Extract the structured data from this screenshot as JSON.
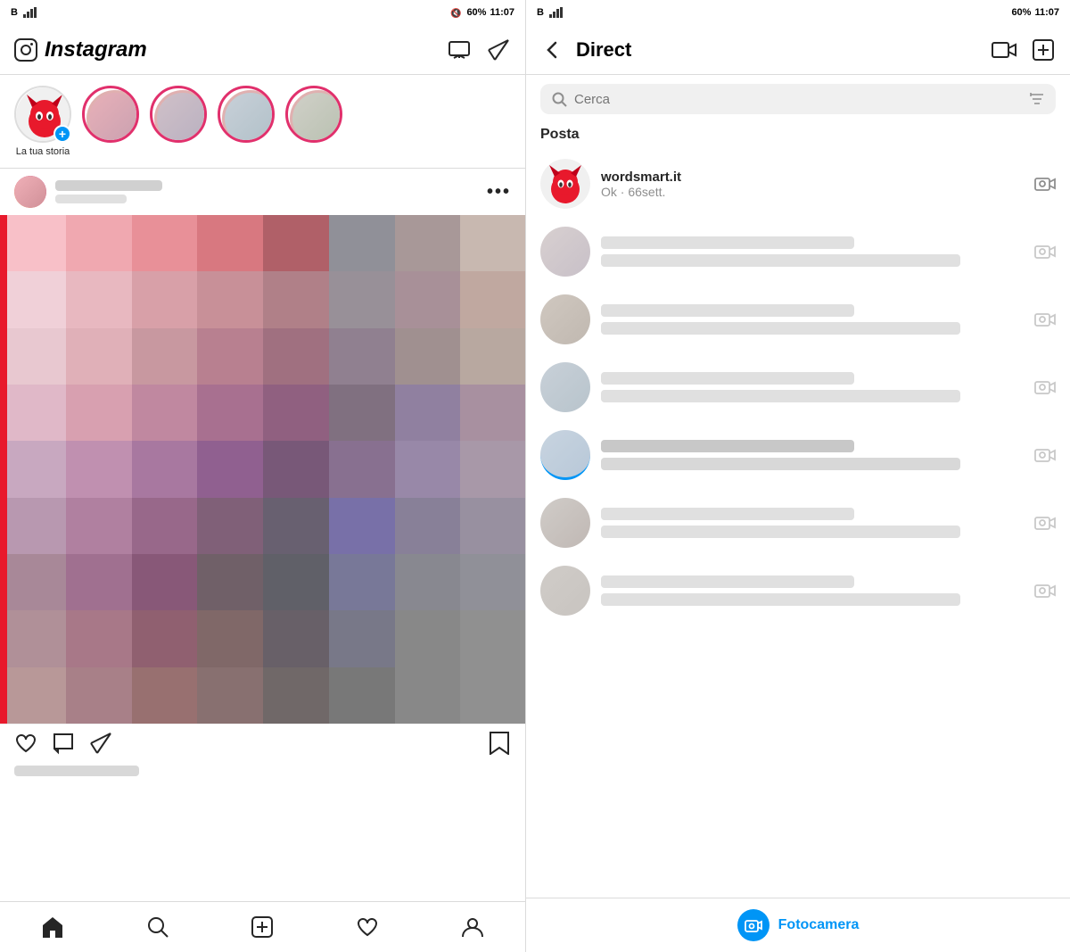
{
  "left": {
    "status": {
      "left": "B",
      "battery": "60%",
      "time": "11:07"
    },
    "header": {
      "title": "Instagram"
    },
    "stories": {
      "my_story_label": "La tua storia"
    },
    "post": {
      "more_dots": "•••",
      "actions_visible": true
    },
    "nav": {
      "items": [
        "home",
        "search",
        "add",
        "heart",
        "profile"
      ]
    }
  },
  "right": {
    "status": {
      "battery": "60%",
      "time": "11:07"
    },
    "header": {
      "title": "Direct",
      "back_label": "←"
    },
    "search": {
      "placeholder": "Cerca"
    },
    "section": {
      "label": "Posta"
    },
    "messages": [
      {
        "username": "wordsmart.it",
        "preview": "Ok · 66sett."
      }
    ],
    "camera_bar": {
      "label": "Fotocamera"
    }
  },
  "pixel_colors": [
    "#f8c0c8",
    "#f0a8b0",
    "#e89098",
    "#d87880",
    "#b06068",
    "#909098",
    "#a89898",
    "#c8b8b0",
    "#f0d0d8",
    "#e8b8c0",
    "#d8a0a8",
    "#c89098",
    "#b08088",
    "#989098",
    "#a89098",
    "#c0a8a0",
    "#e8c8d0",
    "#e0b0b8",
    "#c898a0",
    "#b88090",
    "#a07080",
    "#908090",
    "#a09090",
    "#b8a8a0",
    "#e0b8c8",
    "#d8a0b0",
    "#c088a0",
    "#a87090",
    "#906080",
    "#807080",
    "#9080a0",
    "#a890a0",
    "#c8a8c0",
    "#c090b0",
    "#a878a0",
    "#906090",
    "#785878",
    "#887090",
    "#9888a8",
    "#a898a8",
    "#b898b0",
    "#b080a0",
    "#98688a",
    "#806078",
    "#686070",
    "#7870a8",
    "#888098",
    "#9890a0",
    "#a88898",
    "#a07090",
    "#885878",
    "#706068",
    "#606068",
    "#787898",
    "#888890",
    "#909098",
    "#b09098",
    "#a87888",
    "#906070",
    "#806868",
    "#686068",
    "#787888",
    "#888888",
    "#909090",
    "#b89898",
    "#a88088",
    "#987070",
    "#887070",
    "#706868",
    "#787878",
    "#888888",
    "#909090"
  ]
}
